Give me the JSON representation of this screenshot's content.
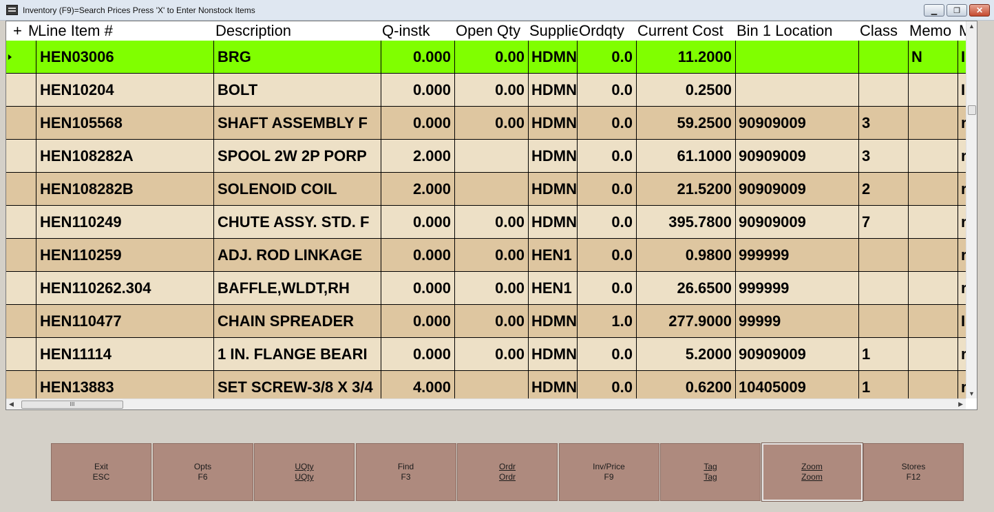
{
  "window": {
    "title": "Inventory (F9)=Search Prices  Press 'X' to Enter Nonstock Items",
    "minimize_symbol": "▁",
    "restore_symbol": "❐",
    "close_symbol": "✕"
  },
  "grid": {
    "columns": [
      {
        "key": "plus",
        "label": "+"
      },
      {
        "key": "m",
        "label": "M"
      },
      {
        "key": "line_item",
        "label": "Line Item #"
      },
      {
        "key": "description",
        "label": "Description"
      },
      {
        "key": "q_instk",
        "label": "Q-instk"
      },
      {
        "key": "open_qty",
        "label": "Open Qty"
      },
      {
        "key": "supplier",
        "label": "Supplier"
      },
      {
        "key": "ordqty",
        "label": "Ordqty"
      },
      {
        "key": "current_cost",
        "label": "Current Cost"
      },
      {
        "key": "bin1",
        "label": "Bin 1 Location"
      },
      {
        "key": "class",
        "label": "Class"
      },
      {
        "key": "memo",
        "label": "Memo"
      },
      {
        "key": "m2",
        "label": "M"
      }
    ],
    "rows": [
      {
        "line_item": "HEN03006",
        "description": "BRG",
        "q_instk": "0.000",
        "open_qty": "0.00",
        "supplier": "HDMN",
        "ordqty": "0.0",
        "current_cost": "11.2000",
        "bin1": "",
        "class": "",
        "memo": "N",
        "m2": "I"
      },
      {
        "line_item": "HEN10204",
        "description": "BOLT",
        "q_instk": "0.000",
        "open_qty": "0.00",
        "supplier": "HDMN",
        "ordqty": "0.0",
        "current_cost": "0.2500",
        "bin1": "",
        "class": "",
        "memo": "",
        "m2": "I"
      },
      {
        "line_item": "HEN105568",
        "description": "SHAFT ASSEMBLY F",
        "q_instk": "0.000",
        "open_qty": "0.00",
        "supplier": "HDMN",
        "ordqty": "0.0",
        "current_cost": "59.2500",
        "bin1": "90909009",
        "class": "3",
        "memo": "",
        "m2": "r"
      },
      {
        "line_item": "HEN108282A",
        "description": "SPOOL 2W 2P PORP",
        "q_instk": "2.000",
        "open_qty": "",
        "supplier": "HDMN",
        "ordqty": "0.0",
        "current_cost": "61.1000",
        "bin1": "90909009",
        "class": "3",
        "memo": "",
        "m2": "r"
      },
      {
        "line_item": "HEN108282B",
        "description": "SOLENOID COIL",
        "q_instk": "2.000",
        "open_qty": "",
        "supplier": "HDMN",
        "ordqty": "0.0",
        "current_cost": "21.5200",
        "bin1": "90909009",
        "class": "2",
        "memo": "",
        "m2": "r"
      },
      {
        "line_item": "HEN110249",
        "description": "CHUTE ASSY. STD. F",
        "q_instk": "0.000",
        "open_qty": "0.00",
        "supplier": "HDMN",
        "ordqty": "0.0",
        "current_cost": "395.7800",
        "bin1": "90909009",
        "class": "7",
        "memo": "",
        "m2": "r"
      },
      {
        "line_item": "HEN110259",
        "description": "ADJ. ROD LINKAGE",
        "q_instk": "0.000",
        "open_qty": "0.00",
        "supplier": "HEN1",
        "ordqty": "0.0",
        "current_cost": "0.9800",
        "bin1": "999999",
        "class": "",
        "memo": "",
        "m2": "r"
      },
      {
        "line_item": "HEN110262.304",
        "description": "BAFFLE,WLDT,RH",
        "q_instk": "0.000",
        "open_qty": "0.00",
        "supplier": "HEN1",
        "ordqty": "0.0",
        "current_cost": "26.6500",
        "bin1": "999999",
        "class": "",
        "memo": "",
        "m2": "r"
      },
      {
        "line_item": "HEN110477",
        "description": "CHAIN SPREADER",
        "q_instk": "0.000",
        "open_qty": "0.00",
        "supplier": "HDMN",
        "ordqty": "1.0",
        "current_cost": "277.9000",
        "bin1": "99999",
        "class": "",
        "memo": "",
        "m2": "I"
      },
      {
        "line_item": "HEN11114",
        "description": "1 IN. FLANGE BEARI",
        "q_instk": "0.000",
        "open_qty": "0.00",
        "supplier": "HDMN",
        "ordqty": "0.0",
        "current_cost": "5.2000",
        "bin1": "90909009",
        "class": "1",
        "memo": "",
        "m2": "r"
      },
      {
        "line_item": "HEN13883",
        "description": "SET SCREW-3/8 X 3/4",
        "q_instk": "4.000",
        "open_qty": "",
        "supplier": "HDMN",
        "ordqty": "0.0",
        "current_cost": "0.6200",
        "bin1": "10405009",
        "class": "1",
        "memo": "",
        "m2": "r"
      }
    ]
  },
  "scroll": {
    "h_thumb_grip": "III",
    "up": "▲",
    "down": "▼",
    "left": "◀",
    "right": "▶"
  },
  "function_keys": [
    {
      "line1": "Exit",
      "line2": "ESC",
      "underline": false
    },
    {
      "line1": "Opts",
      "line2": "F6",
      "underline": false
    },
    {
      "line1": "UQty",
      "line2": "UQty",
      "underline": true
    },
    {
      "line1": "Find",
      "line2": "F3",
      "underline": false
    },
    {
      "line1": "Ordr",
      "line2": "Ordr",
      "underline": true
    },
    {
      "line1": "Inv/Price",
      "line2": "F9",
      "underline": false
    },
    {
      "line1": "Tag",
      "line2": "Tag",
      "underline": true
    },
    {
      "line1": "Zoom",
      "line2": "Zoom",
      "underline": true
    },
    {
      "line1": "Stores",
      "line2": "F12",
      "underline": false
    }
  ]
}
